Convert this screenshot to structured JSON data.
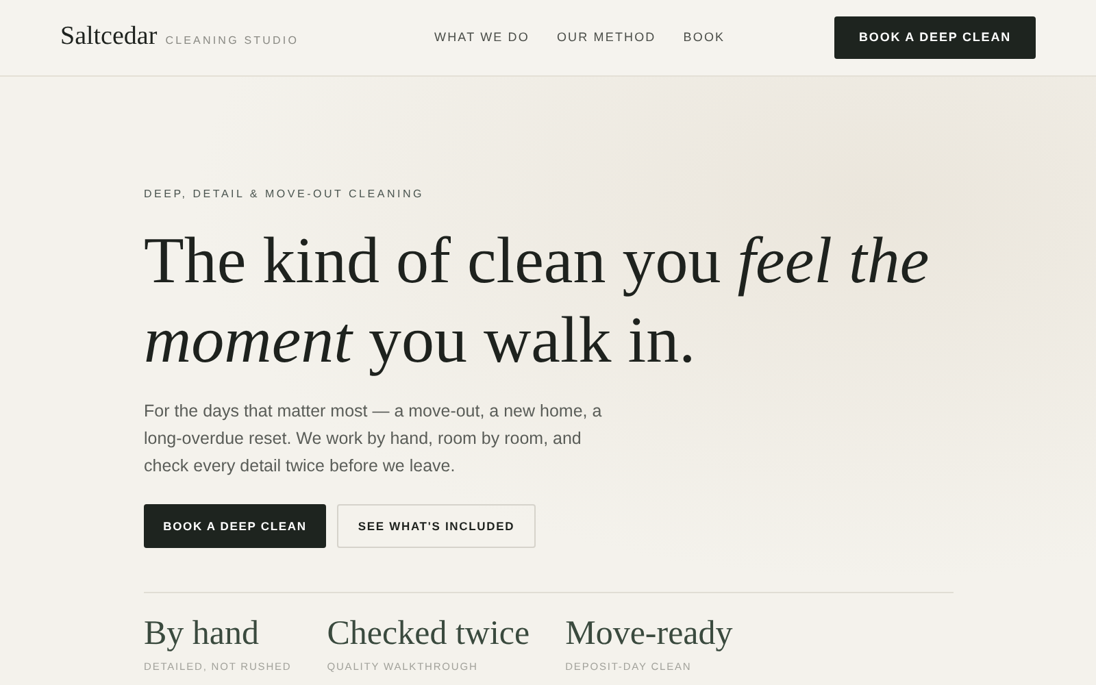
{
  "brand": {
    "name": "Saltcedar",
    "tagline": "CLEANING STUDIO"
  },
  "nav": {
    "links": [
      "WHAT WE DO",
      "OUR METHOD",
      "BOOK"
    ],
    "cta": "BOOK A DEEP CLEAN"
  },
  "hero": {
    "eyebrow": "DEEP, DETAIL & MOVE-OUT CLEANING",
    "headline": "The kind of clean you *feel the moment* you walk in.",
    "body": "For the days that matter most — a move-out, a new home, a long-overdue reset. We work by hand, room by room, and check every detail twice before we leave.",
    "primary_button": "BOOK A DEEP CLEAN",
    "secondary_button": "SEE WHAT'S INCLUDED"
  },
  "features": [
    {
      "title": "By hand",
      "caption": "DETAILED, NOT RUSHED"
    },
    {
      "title": "Checked twice",
      "caption": "QUALITY WALKTHROUGH"
    },
    {
      "title": "Move-ready",
      "caption": "DEPOSIT-DAY CLEAN"
    }
  ]
}
